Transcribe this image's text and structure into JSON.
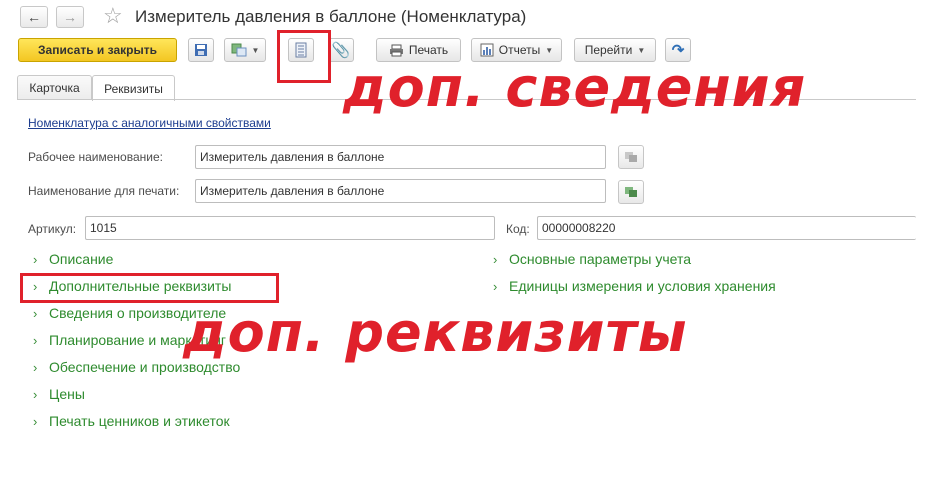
{
  "window": {
    "title": "Измеритель давления в баллоне (Номенклатура)",
    "nav_back_icon": "arrow-left-icon",
    "nav_forward_icon": "arrow-right-icon",
    "favorite_icon": "star-icon"
  },
  "toolbar": {
    "save_close_label": "Записать и закрыть",
    "print_label": "Печать",
    "reports_label": "Отчеты",
    "goto_label": "Перейти",
    "icons": [
      "save-icon",
      "create-on-basis-icon",
      "additional-info-icon",
      "attachments-icon",
      "print-icon",
      "reports-icon",
      "help-icon"
    ]
  },
  "tabs": [
    {
      "label": "Карточка",
      "active": false
    },
    {
      "label": "Реквизиты",
      "active": true
    }
  ],
  "form": {
    "similar_link": "Номенклатура с аналогичными свойствами",
    "working_name_label": "Рабочее наименование:",
    "working_name_value": "Измеритель давления в баллоне",
    "print_name_label": "Наименование для печати:",
    "print_name_value": "Измеритель давления в баллоне",
    "article_label": "Артикул:",
    "article_value": "1015",
    "code_label": "Код:",
    "code_value": "00000008220"
  },
  "groups_left": [
    "Описание",
    "Дополнительные реквизиты",
    "Сведения о производителе",
    "Планирование и маркетинг",
    "Обеспечение и производство",
    "Цены",
    "Печать ценников и этикеток"
  ],
  "groups_right": [
    "Основные параметры учета",
    "Единицы измерения и условия хранения"
  ],
  "annotations": {
    "top": "доп. сведения",
    "bottom": "доп. реквизиты",
    "color": "#e0212b"
  },
  "colors": {
    "primary_button": "#f5cc2b",
    "group_link": "#2e8b2e",
    "hyperlink": "#1d3d8f"
  }
}
